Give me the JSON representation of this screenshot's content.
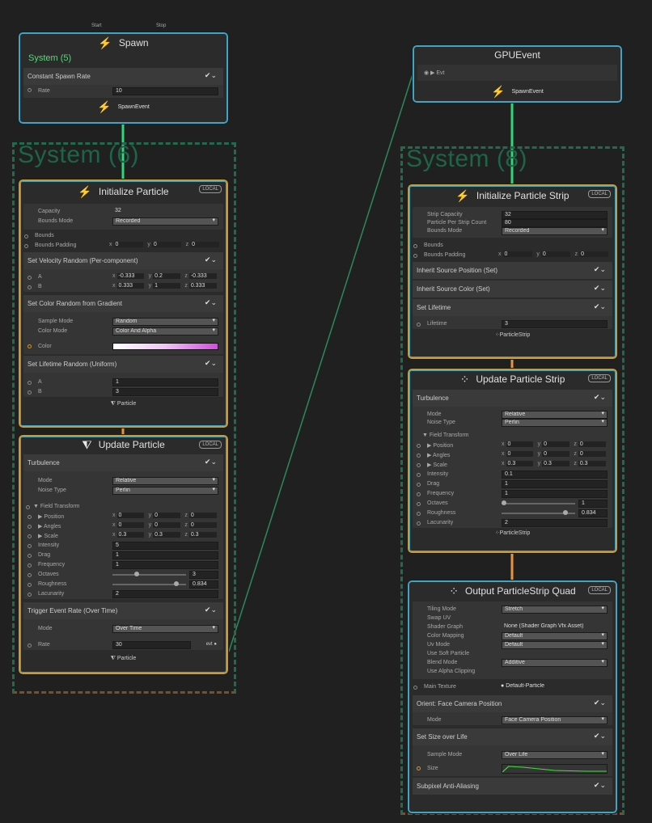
{
  "spawn": {
    "title": "Spawn",
    "system_name": "System (5)",
    "start": "Start",
    "stop": "Stop",
    "block_title": "Constant Spawn Rate",
    "rate_label": "Rate",
    "rate_value": "10",
    "out": "SpawnEvent"
  },
  "gpuevent": {
    "title": "GPUEvent",
    "evt": "Evt",
    "out": "SpawnEvent"
  },
  "system6": {
    "title": "System (6)"
  },
  "system8": {
    "title": "System (8)"
  },
  "init_particle": {
    "title": "Initialize Particle",
    "local": "LOCAL",
    "capacity_label": "Capacity",
    "capacity": "32",
    "bounds_mode_label": "Bounds Mode",
    "bounds_mode": "Recorded",
    "bounds_label": "Bounds",
    "bounds_padding_label": "Bounds Padding",
    "bp": [
      "0",
      "0",
      "0"
    ],
    "vel_title": "Set Velocity Random (Per-component)",
    "a_label": "A",
    "b_label": "B",
    "a": [
      "-0.333",
      "0.2",
      "-0.333"
    ],
    "b": [
      "0.333",
      "1",
      "0.333"
    ],
    "color_title": "Set Color Random from Gradient",
    "sample_mode_label": "Sample Mode",
    "sample_mode": "Random",
    "color_mode_label": "Color Mode",
    "color_mode": "Color And Alpha",
    "color_label": "Color",
    "life_title": "Set Lifetime Random (Uniform)",
    "la": "1",
    "lb": "3",
    "out": "Particle"
  },
  "update_particle": {
    "title": "Update Particle",
    "local": "LOCAL",
    "turb": "Turbulence",
    "mode_label": "Mode",
    "mode": "Relative",
    "noise_label": "Noise Type",
    "noise": "Perlin",
    "field": "Field Transform",
    "pos_label": "Position",
    "ang_label": "Angles",
    "scale_label": "Scale",
    "pos": [
      "0",
      "0",
      "0"
    ],
    "ang": [
      "0",
      "0",
      "0"
    ],
    "scale": [
      "0.3",
      "0.3",
      "0.3"
    ],
    "intensity_label": "Intensity",
    "intensity": "5",
    "drag_label": "Drag",
    "drag": "1",
    "freq_label": "Frequency",
    "freq": "1",
    "oct_label": "Octaves",
    "oct": "3",
    "rough_label": "Roughness",
    "rough": "0.834",
    "lac_label": "Lacunarity",
    "lac": "2",
    "trig_title": "Trigger Event Rate (Over Time)",
    "trig_mode": "Over Time",
    "rate_label": "Rate",
    "rate": "30",
    "evt": "evt",
    "out": "Particle"
  },
  "init_strip": {
    "title": "Initialize Particle Strip",
    "local": "LOCAL",
    "cap_label": "Strip Capacity",
    "cap": "32",
    "pps_label": "Particle Per Strip Count",
    "pps": "80",
    "bm_label": "Bounds Mode",
    "bm": "Recorded",
    "bounds_label": "Bounds",
    "bp_label": "Bounds Padding",
    "bp": [
      "0",
      "0",
      "0"
    ],
    "isp": "Inherit Source Position (Set)",
    "isc": "Inherit Source Color (Set)",
    "sl": "Set Lifetime",
    "lifetime_label": "Lifetime",
    "lifetime": "3",
    "out": "ParticleStrip"
  },
  "update_strip": {
    "title": "Update Particle Strip",
    "local": "LOCAL",
    "turb": "Turbulence",
    "mode": "Relative",
    "noise": "Perlin",
    "pos": [
      "0",
      "0",
      "0"
    ],
    "ang": [
      "0",
      "0",
      "0"
    ],
    "scale": [
      "0.3",
      "0.3",
      "0.3"
    ],
    "intensity": "0.1",
    "drag": "1",
    "freq": "1",
    "oct": "1",
    "rough": "0.834",
    "lac": "2",
    "out": "ParticleStrip"
  },
  "output_strip": {
    "title": "Output ParticleStrip Quad",
    "local": "LOCAL",
    "tiling_label": "Tiling Mode",
    "tiling": "Stretch",
    "swap_label": "Swap UV",
    "sg_label": "Shader Graph",
    "sg": "None (Shader Graph Vfx Asset)",
    "cm_label": "Color Mapping",
    "cm": "Default",
    "uv_label": "Uv Mode",
    "uv": "Default",
    "soft_label": "Use Soft Particle",
    "blend_label": "Blend Mode",
    "blend": "Additive",
    "alpha_label": "Use Alpha Clipping",
    "tex_label": "Main Texture",
    "tex": "Default-Particle",
    "orient": "Orient: Face Camera Position",
    "omode": "Face Camera Position",
    "size_title": "Set Size over Life",
    "sm": "Over Life",
    "size_label": "Size",
    "aa": "Subpixel Anti-Aliasing"
  }
}
